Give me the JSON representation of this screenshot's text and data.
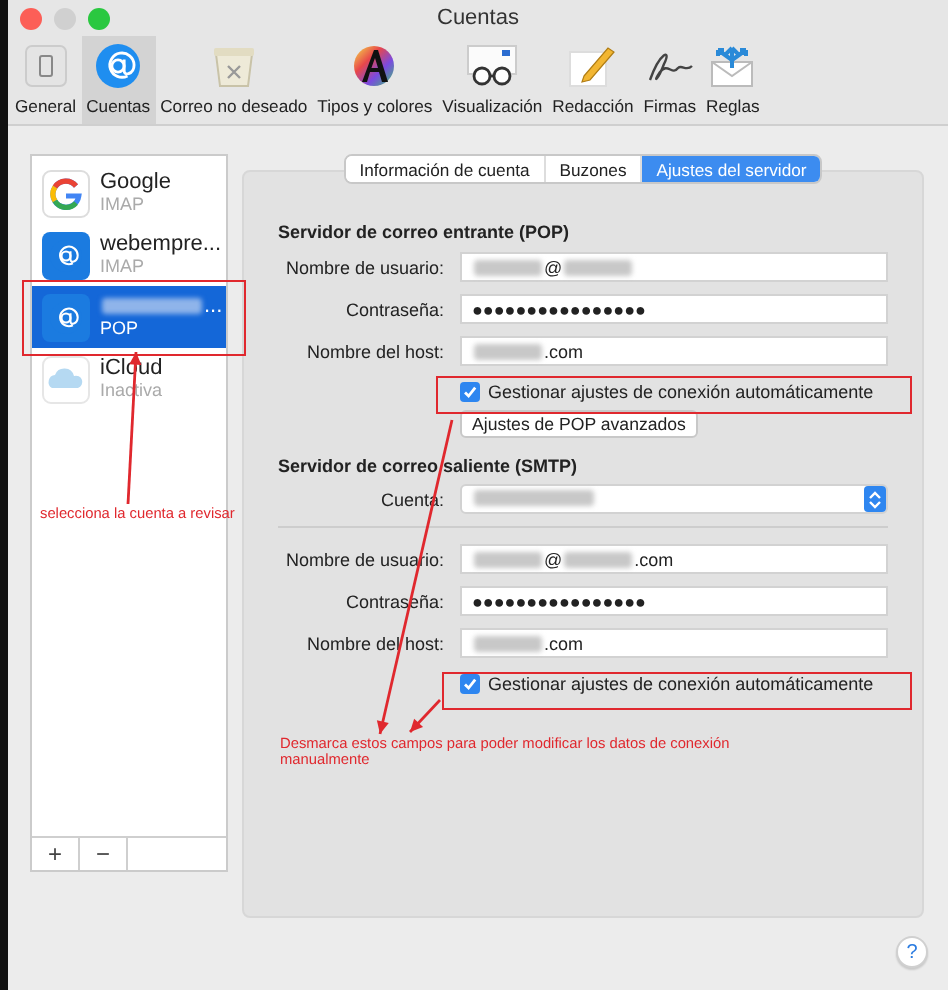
{
  "window": {
    "title": "Cuentas"
  },
  "toolbar": [
    {
      "label": "General",
      "selected": false
    },
    {
      "label": "Cuentas",
      "selected": true
    },
    {
      "label": "Correo no deseado",
      "selected": false
    },
    {
      "label": "Tipos y colores",
      "selected": false
    },
    {
      "label": "Visualización",
      "selected": false
    },
    {
      "label": "Redacción",
      "selected": false
    },
    {
      "label": "Firmas",
      "selected": false
    },
    {
      "label": "Reglas",
      "selected": false
    }
  ],
  "accounts": [
    {
      "name_parts": [
        {
          "kind": "text",
          "text": "Google"
        }
      ],
      "type": "IMAP",
      "selected": false
    },
    {
      "name_parts": [
        {
          "kind": "text",
          "text": "webempre..."
        }
      ],
      "type": "IMAP",
      "selected": false
    },
    {
      "name_parts": [
        {
          "kind": "redacted"
        },
        {
          "kind": "text",
          "text": "..."
        }
      ],
      "type": "POP",
      "selected": true
    },
    {
      "name_parts": [
        {
          "kind": "text",
          "text": "iCloud"
        }
      ],
      "type": "Inactiva",
      "selected": false
    }
  ],
  "list_buttons": [
    "+",
    "−"
  ],
  "tabs": [
    {
      "label": "Información de cuenta",
      "selected": false
    },
    {
      "label": "Buzones",
      "selected": false
    },
    {
      "label": "Ajustes del servidor",
      "selected": true
    }
  ],
  "incoming": {
    "heading": "Servidor de correo entrante (POP)",
    "fields": [
      {
        "label": "Nombre de usuario:",
        "parts": [
          {
            "kind": "redacted"
          },
          {
            "kind": "text",
            "text": "@"
          },
          {
            "kind": "redacted"
          }
        ]
      },
      {
        "label": "Contraseña:",
        "parts": [
          {
            "kind": "text",
            "text": "●●●●●●●●●●●●●●●●"
          }
        ]
      },
      {
        "label": "Nombre del host:",
        "parts": [
          {
            "kind": "redacted"
          },
          {
            "kind": "text",
            "text": ".com"
          }
        ]
      }
    ],
    "auto_manage": {
      "label": "Gestionar ajustes de conexión automáticamente",
      "checked": true
    },
    "advanced_button": "Ajustes de POP avanzados"
  },
  "outgoing": {
    "heading": "Servidor de correo saliente (SMTP)",
    "account": {
      "label": "Cuenta:",
      "parts": [
        {
          "kind": "redacted"
        }
      ]
    },
    "fields": [
      {
        "label": "Nombre de usuario:",
        "parts": [
          {
            "kind": "redacted"
          },
          {
            "kind": "text",
            "text": "@"
          },
          {
            "kind": "redacted"
          },
          {
            "kind": "text",
            "text": ".com"
          }
        ]
      },
      {
        "label": "Contraseña:",
        "parts": [
          {
            "kind": "text",
            "text": "●●●●●●●●●●●●●●●●"
          }
        ]
      },
      {
        "label": "Nombre del host:",
        "parts": [
          {
            "kind": "redacted"
          },
          {
            "kind": "text",
            "text": ".com"
          }
        ]
      }
    ],
    "auto_manage": {
      "label": "Gestionar ajustes de conexión automáticamente",
      "checked": true
    }
  },
  "annotations": [
    {
      "text": "selecciona la cuenta a revisar"
    },
    {
      "text": "Desmarca estos campos para poder modificar los datos de conexión manualmente"
    }
  ],
  "help": "?"
}
